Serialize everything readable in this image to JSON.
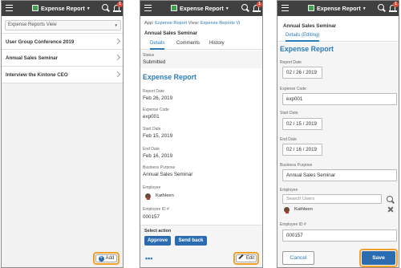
{
  "app_title": "Expense Report",
  "notification_count": "1",
  "list_screen": {
    "view_selector": "Expense Reports View",
    "records": [
      "User Group Conference 2019",
      "Annual Sales Seminar",
      "Interview the Kintone CEO"
    ],
    "add_button": "Add"
  },
  "detail_screen": {
    "breadcrumb": {
      "app_label": "App:",
      "app_link": "Expense Report",
      "view_label": "View:",
      "view_link": "Expense Reports Vi"
    },
    "record_title": "Annual Sales Seminar",
    "tabs": [
      "Details",
      "Comments",
      "History"
    ],
    "status_label": "Status",
    "status_value": "Submitted",
    "section_title": "Expense Report",
    "fields": [
      {
        "label": "Report Date",
        "value": "Feb 26, 2019"
      },
      {
        "label": "Expense Code",
        "value": "exp001"
      },
      {
        "label": "Start Date",
        "value": "Feb 15, 2019"
      },
      {
        "label": "End Date",
        "value": "Feb 16, 2019"
      },
      {
        "label": "Business Purpose",
        "value": "Annual Sales Seminar"
      }
    ],
    "employee_label": "Employee",
    "employee_name": "Kathleen",
    "employee_id_label": "Employee ID #",
    "employee_id_value": "000157",
    "select_action_label": "Select action",
    "approve_button": "Approve",
    "send_back_button": "Send back",
    "more_label": "•••",
    "edit_button": "Edit"
  },
  "edit_screen": {
    "record_title": "Annual Sales Seminar",
    "tab_label": "Details (Editing)",
    "section_title": "Expense Report",
    "report_date_label": "Report Date",
    "report_date": {
      "month": "02",
      "day": "26",
      "year": "2019"
    },
    "expense_code_label": "Expense Code",
    "expense_code_value": "exp001",
    "start_date_label": "Start Date",
    "start_date": {
      "month": "02",
      "day": "15",
      "year": "2019"
    },
    "end_date_label": "End Date",
    "end_date": {
      "month": "02",
      "day": "16",
      "year": "2019"
    },
    "business_purpose_label": "Business Purpose",
    "business_purpose_value": "Annual Sales Seminar",
    "employee_label": "Employee",
    "search_placeholder": "Search Users",
    "employee_name": "Kathleen",
    "employee_id_label": "Employee ID #",
    "employee_id_value": "000157",
    "cancel_button": "Cancel",
    "save_button": "Save",
    "date_separator": "/"
  },
  "colors": {
    "accent": "#2b7bb9",
    "highlight": "#f1a12b",
    "topbar": "#404040"
  }
}
